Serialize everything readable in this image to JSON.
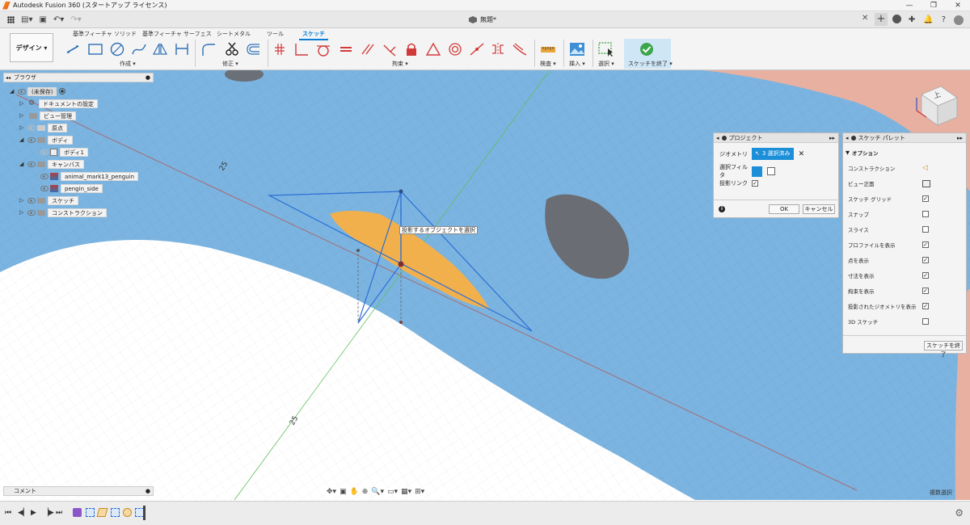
{
  "title_bar": {
    "title": "Autodesk Fusion 360 (スタートアップ ライセンス)"
  },
  "document_tab": {
    "name": "無題*"
  },
  "toolbar": {
    "workspace": "デザイン ▾",
    "tabs": [
      "基準フィーチャ ソリッド",
      "基準フィーチャ サーフェス",
      "シートメタル",
      "ツール",
      "スケッチ"
    ],
    "active_tab": "スケッチ",
    "groups": {
      "create": "作成 ▾",
      "modify": "修正 ▾",
      "constraints": "拘束 ▾",
      "inspect": "検査 ▾",
      "insert": "挿入 ▾",
      "select": "選択 ▾",
      "finish": "スケッチを終了 ▾"
    }
  },
  "browser": {
    "header": "ブラウザ",
    "items": [
      {
        "label": "(未保存)",
        "level": 0
      },
      {
        "label": "ドキュメントの設定",
        "level": 1
      },
      {
        "label": "ビュー管理",
        "level": 1
      },
      {
        "label": "原点",
        "level": 1
      },
      {
        "label": "ボディ",
        "level": 1
      },
      {
        "label": "ボディ1",
        "level": 2
      },
      {
        "label": "キャンバス",
        "level": 1
      },
      {
        "label": "animal_mark13_penguin",
        "level": 2
      },
      {
        "label": "pengin_side",
        "level": 2
      },
      {
        "label": "スケッチ",
        "level": 1
      },
      {
        "label": "コンストラクション",
        "level": 1
      }
    ]
  },
  "viewport": {
    "axis_label_1": "25",
    "axis_label_2": "25",
    "tooltip": "投影するオブジェクトを選択",
    "status": "複数選択",
    "view_cube_label": "上"
  },
  "project_panel": {
    "title": "プロジェクト",
    "geometry_label": "ジオメトリ",
    "geometry_value": "3 選択済み",
    "filter_label": "選択フィルタ",
    "link_label": "投影リンク",
    "ok": "OK",
    "cancel": "キャンセル"
  },
  "sketch_palette": {
    "title": "スケッチ パレット",
    "section": "オプション",
    "options": [
      {
        "label": "コンストラクション",
        "type": "icon"
      },
      {
        "label": "ビュー正面",
        "type": "icon"
      },
      {
        "label": "スケッチ グリッド",
        "type": "check",
        "checked": true
      },
      {
        "label": "スナップ",
        "type": "check",
        "checked": false
      },
      {
        "label": "スライス",
        "type": "check",
        "checked": false
      },
      {
        "label": "プロファイルを表示",
        "type": "check",
        "checked": true
      },
      {
        "label": "点を表示",
        "type": "check",
        "checked": true
      },
      {
        "label": "寸法を表示",
        "type": "check",
        "checked": true
      },
      {
        "label": "拘束を表示",
        "type": "check",
        "checked": true
      },
      {
        "label": "投影されたジオメトリを表示",
        "type": "check",
        "checked": true
      },
      {
        "label": "3D スケッチ",
        "type": "check",
        "checked": false
      }
    ],
    "finish": "スケッチを終了"
  },
  "comments": {
    "label": "コメント"
  },
  "colors": {
    "accent": "#0a7ed6",
    "canvas_blue": "#7bb4e0",
    "penguin_fill": "#f2b04d",
    "body_red": "#e7b0a0"
  }
}
